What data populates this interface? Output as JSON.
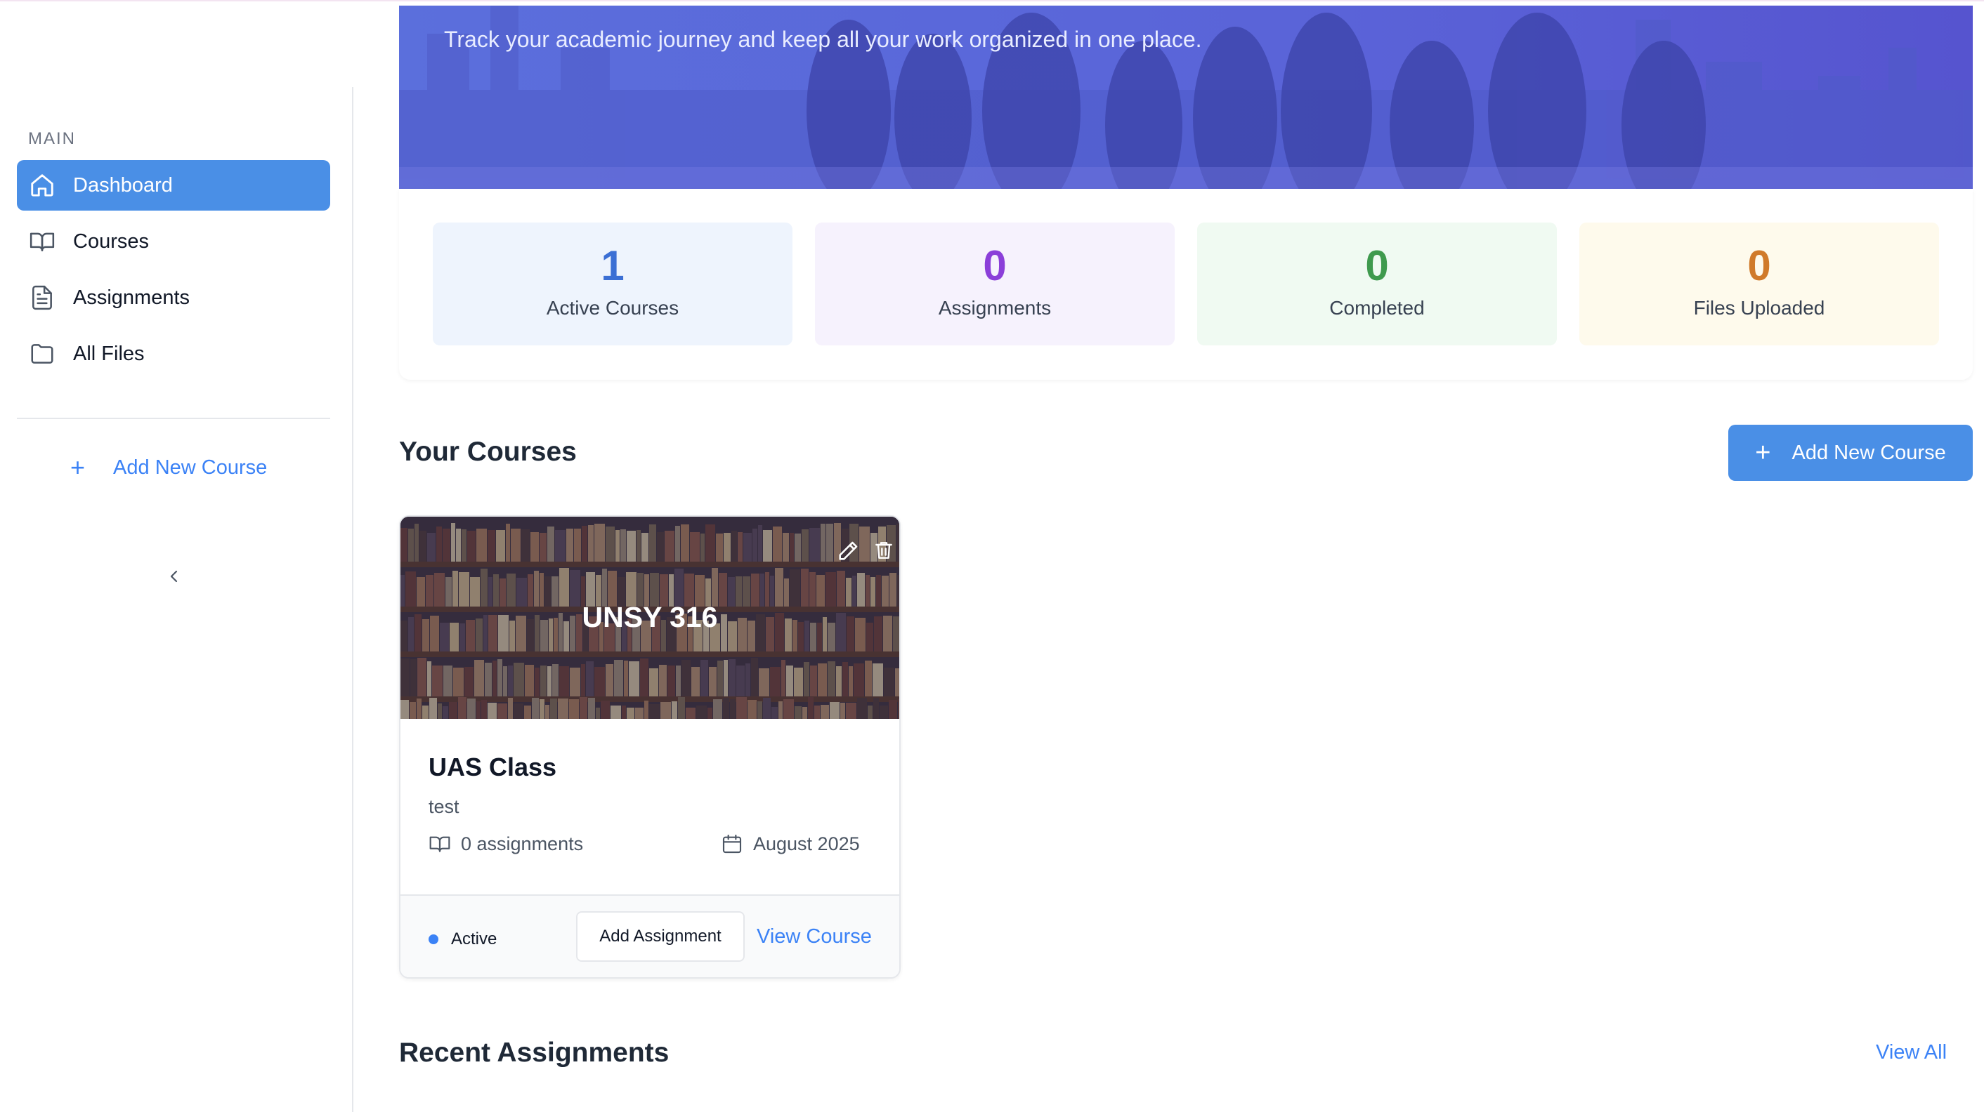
{
  "hero": {
    "subtitle": "Track your academic journey and keep all your work organized in one place."
  },
  "sidebar": {
    "section_label": "MAIN",
    "items": [
      {
        "label": "Dashboard",
        "icon": "home-icon",
        "active": true
      },
      {
        "label": "Courses",
        "icon": "book-icon",
        "active": false
      },
      {
        "label": "Assignments",
        "icon": "document-icon",
        "active": false
      },
      {
        "label": "All Files",
        "icon": "folder-icon",
        "active": false
      }
    ],
    "add_course_label": "Add New Course",
    "collapse_icon": "chevron-left-icon"
  },
  "stats": [
    {
      "value": "1",
      "label": "Active Courses",
      "color": "#3b6fd4",
      "bg": "#eef4fd"
    },
    {
      "value": "0",
      "label": "Assignments",
      "color": "#8b3fd9",
      "bg": "#f6f2fd"
    },
    {
      "value": "0",
      "label": "Completed",
      "color": "#3f9a4e",
      "bg": "#f0faf2"
    },
    {
      "value": "0",
      "label": "Files Uploaded",
      "color": "#d07a2a",
      "bg": "#fefaec"
    }
  ],
  "courses_section": {
    "title": "Your Courses",
    "add_button_label": "Add New Course"
  },
  "course_card": {
    "code": "UNSY 316",
    "title": "UAS Class",
    "description": "test",
    "assignments_count": "0 assignments",
    "date": "August 2025",
    "status": "Active",
    "add_assignment_label": "Add Assignment",
    "view_course_label": "View Course",
    "edit_icon": "pencil-icon",
    "delete_icon": "trash-icon"
  },
  "recent_section": {
    "title": "Recent Assignments",
    "view_all_label": "View All"
  },
  "colors": {
    "accent": "#4a8fe6",
    "link": "#3b82f6",
    "hero": "#5a63d8"
  }
}
